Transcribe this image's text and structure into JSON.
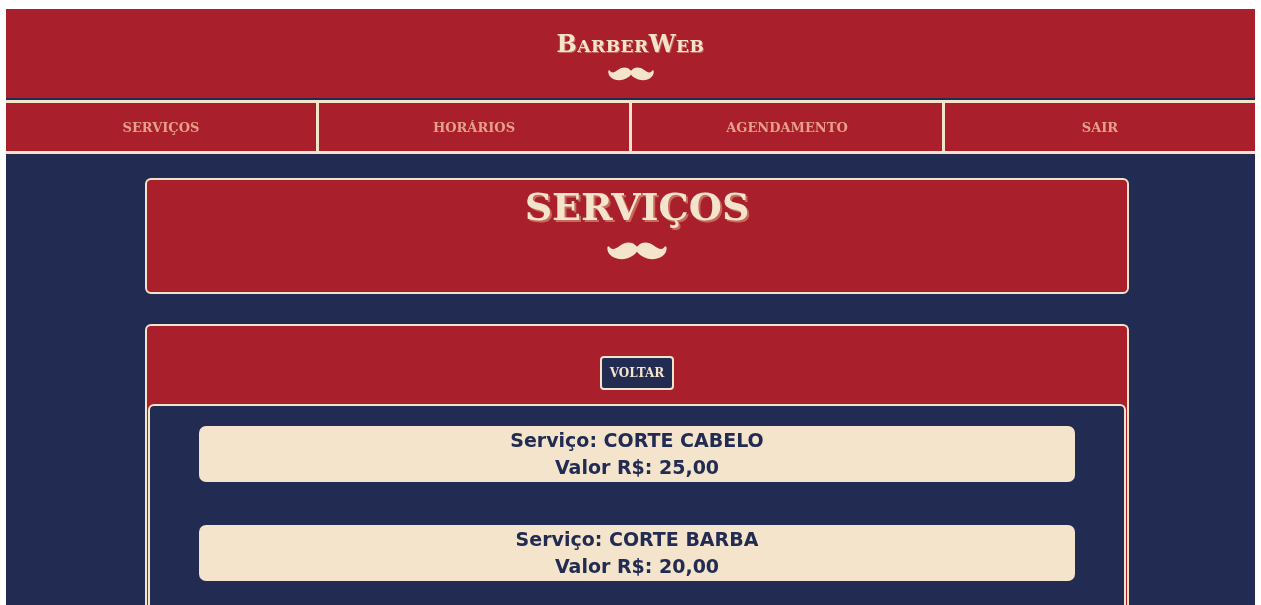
{
  "header": {
    "title": "BarberWeb"
  },
  "nav": [
    {
      "label": "SERVIÇOS"
    },
    {
      "label": "HORÁRIOS"
    },
    {
      "label": "AGENDAMENTO"
    },
    {
      "label": "SAIR"
    }
  ],
  "page_title": "SERVIÇOS",
  "back_button": "VOLTAR",
  "services": [
    {
      "name": "Serviço: CORTE CABELO",
      "price": "Valor R$: 25,00"
    },
    {
      "name": "Serviço: CORTE BARBA",
      "price": "Valor R$: 20,00"
    }
  ]
}
